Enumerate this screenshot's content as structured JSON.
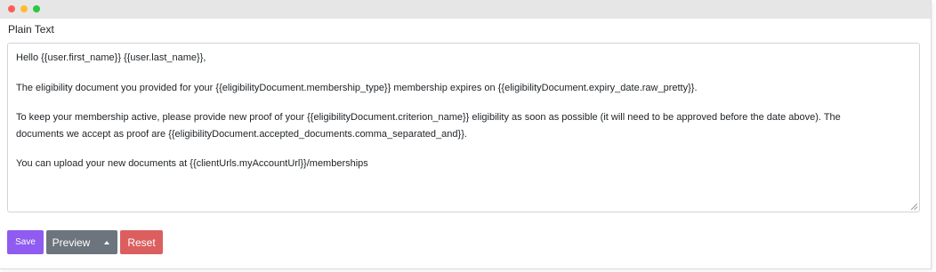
{
  "window": {
    "controls": [
      "close",
      "minimize",
      "maximize"
    ]
  },
  "editor": {
    "label": "Plain Text",
    "lines": [
      "Hello {{user.first_name}} {{user.last_name}},",
      "The eligibility document you provided for your {{eligibilityDocument.membership_type}} membership expires on {{eligibilityDocument.expiry_date.raw_pretty}}.",
      "To keep your membership active, please provide new proof of your {{eligibilityDocument.criterion_name}} eligibility as soon as possible (it will need to be approved before the date above). The",
      "documents we accept as proof are {{eligibilityDocument.accepted_documents.comma_separated_and}}.",
      "You can upload your new documents at {{clientUrls.myAccountUrl}}/memberships"
    ]
  },
  "buttons": {
    "save": "Save",
    "preview": "Preview",
    "reset": "Reset"
  },
  "colors": {
    "save": "#8f5bf0",
    "preview": "#6c757d",
    "reset": "#dc5f5f"
  }
}
